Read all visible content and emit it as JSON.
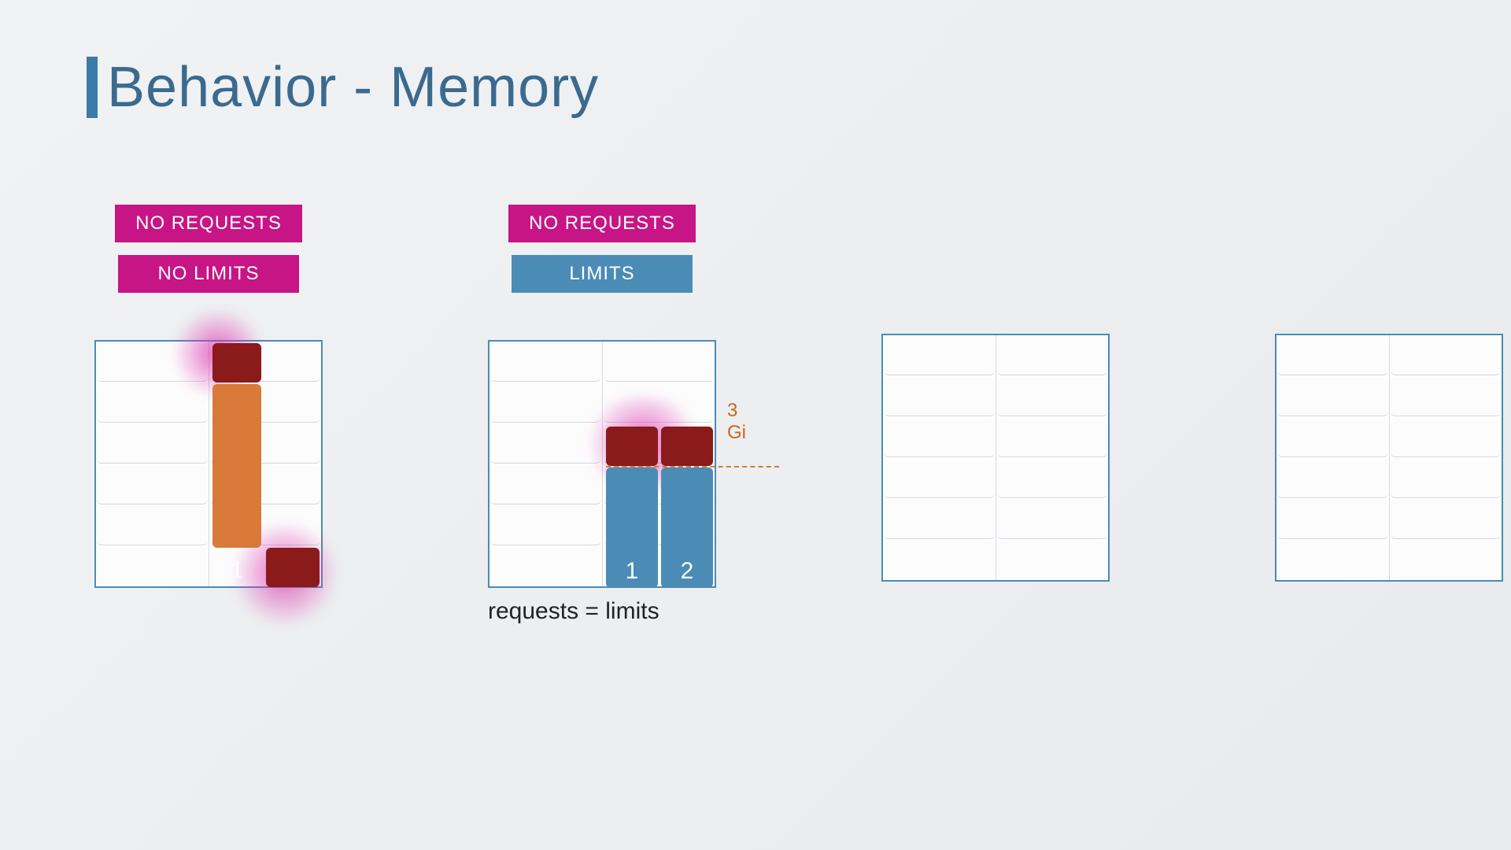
{
  "title": "Behavior - Memory",
  "scenarios": [
    {
      "badges": [
        {
          "label": "NO REQUESTS",
          "style": "pink"
        },
        {
          "label": "NO LIMITS",
          "style": "pink"
        }
      ],
      "rows": 6,
      "bars": [
        {
          "column": 1,
          "label": "1",
          "segments": [
            {
              "color": "darkred",
              "row_from": 5,
              "row_to": 5
            },
            {
              "color": "orange",
              "row_from": 1,
              "row_to": 4
            },
            {
              "color": "darkred",
              "row_from": 0,
              "row_to": 0
            }
          ],
          "glow_top": true
        },
        {
          "column": 2,
          "label": "",
          "segments": [
            {
              "color": "darkred",
              "row_from": 0,
              "row_to": 0
            }
          ],
          "glow_bottom": true
        }
      ],
      "caption": null,
      "limit": null
    },
    {
      "badges": [
        {
          "label": "NO REQUESTS",
          "style": "pink"
        },
        {
          "label": "LIMITS",
          "style": "blue"
        }
      ],
      "rows": 6,
      "bars": [
        {
          "column": 1,
          "label": "1",
          "segments": [
            {
              "color": "blue",
              "row_from": 0,
              "row_to": 2
            },
            {
              "color": "darkred",
              "row_from": 3,
              "row_to": 3
            }
          ],
          "glow_mid": true
        },
        {
          "column": 2,
          "label": "2",
          "segments": [
            {
              "color": "blue",
              "row_from": 0,
              "row_to": 2
            },
            {
              "color": "darkred",
              "row_from": 3,
              "row_to": 3
            }
          ]
        }
      ],
      "limit": {
        "row": 3,
        "label": "3 Gi"
      },
      "caption": "requests = limits"
    },
    {
      "badges": [],
      "rows": 6,
      "bars": [],
      "limit": null,
      "caption": null
    },
    {
      "badges": [],
      "rows": 6,
      "bars": [],
      "limit": null,
      "caption": null
    }
  ]
}
